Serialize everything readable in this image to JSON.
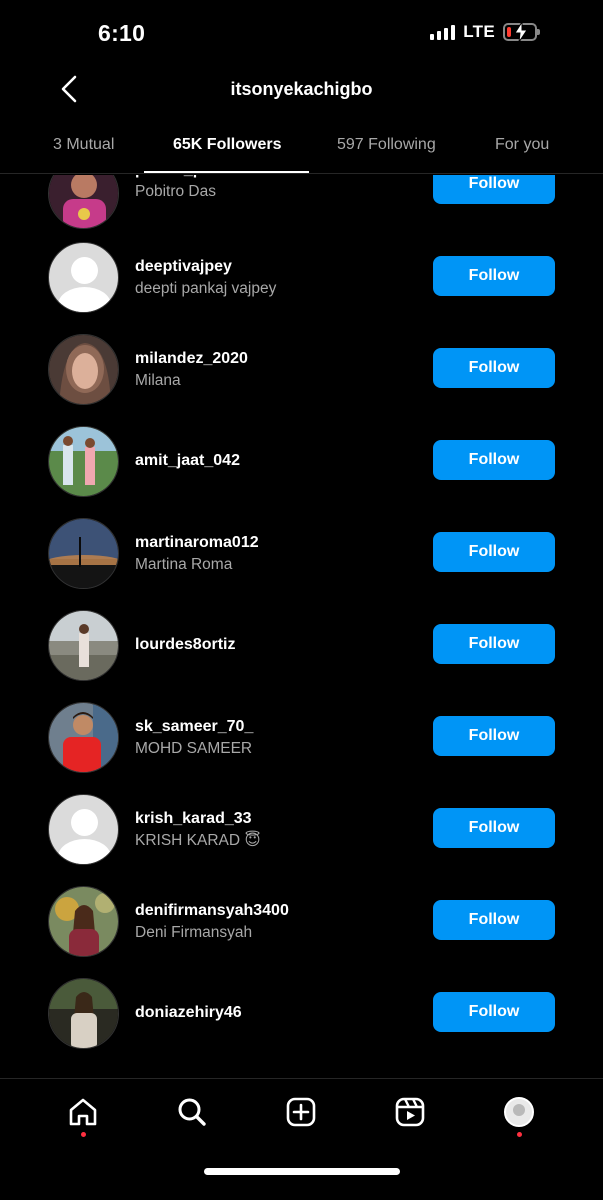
{
  "status_bar": {
    "time": "6:10",
    "network": "LTE",
    "battery_level": 0.15,
    "battery_color": "#ff3b30",
    "charging": true
  },
  "header": {
    "title": "itsonyekachigbo",
    "back_icon": "chevron-left-icon"
  },
  "tabs": [
    {
      "label": "3 Mutual",
      "active": false
    },
    {
      "label": "65K Followers",
      "active": true
    },
    {
      "label": "597 Following",
      "active": false
    },
    {
      "label": "For you",
      "active": false
    }
  ],
  "followers": [
    {
      "username": "pobito_pro",
      "full_name": "Pobitro Das",
      "button": "Follow",
      "avatar": "photo"
    },
    {
      "username": "deeptivajpey",
      "full_name": "deepti pankaj vajpey",
      "button": "Follow",
      "avatar": "default"
    },
    {
      "username": "milandez_2020",
      "full_name": "Milana",
      "button": "Follow",
      "avatar": "photo"
    },
    {
      "username": "amit_jaat_042",
      "full_name": "",
      "button": "Follow",
      "avatar": "photo"
    },
    {
      "username": "martinaroma012",
      "full_name": "Martina Roma",
      "button": "Follow",
      "avatar": "photo"
    },
    {
      "username": "lourdes8ortiz",
      "full_name": "",
      "button": "Follow",
      "avatar": "photo"
    },
    {
      "username": "sk_sameer_70_",
      "full_name": "MOHD SAMEER",
      "button": "Follow",
      "avatar": "photo"
    },
    {
      "username": "krish_karad_33",
      "full_name": "KRISH KARAD 😇",
      "button": "Follow",
      "avatar": "default"
    },
    {
      "username": "denifirmansyah3400",
      "full_name": "Deni Firmansyah",
      "button": "Follow",
      "avatar": "photo"
    },
    {
      "username": "doniazehiry46",
      "full_name": "",
      "button": "Follow",
      "avatar": "photo"
    }
  ],
  "bottom_nav": [
    {
      "icon": "home-icon",
      "notification_dot": true
    },
    {
      "icon": "search-icon",
      "notification_dot": false
    },
    {
      "icon": "create-post-icon",
      "notification_dot": false
    },
    {
      "icon": "reels-icon",
      "notification_dot": false
    },
    {
      "icon": "profile-avatar-icon",
      "notification_dot": true
    }
  ],
  "colors": {
    "follow_button": "#0095f6",
    "background": "#000000",
    "secondary_text": "#a8a8a8",
    "notification_dot": "#ff3040"
  }
}
